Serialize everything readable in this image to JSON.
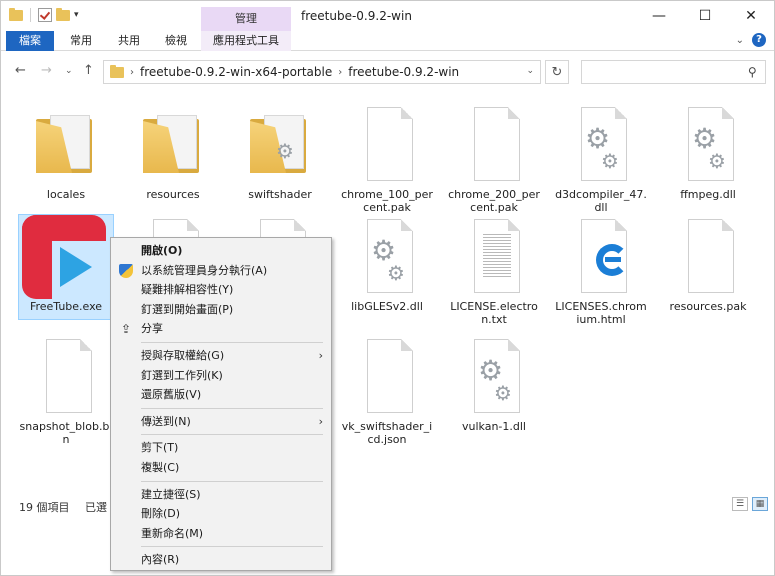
{
  "window": {
    "title": "freetube-0.9.2-win",
    "manage_tab": "管理"
  },
  "ribbon": {
    "tabs": [
      "檔案",
      "常用",
      "共用",
      "檢視",
      "應用程式工具"
    ]
  },
  "address": {
    "segments": [
      "freetube-0.9.2-win-x64-portable",
      "freetube-0.9.2-win"
    ],
    "search_placeholder": ""
  },
  "files": [
    {
      "name": "locales",
      "type": "folder"
    },
    {
      "name": "resources",
      "type": "folder"
    },
    {
      "name": "swiftshader",
      "type": "folder"
    },
    {
      "name": "chrome_100_percent.pak",
      "type": "blank"
    },
    {
      "name": "chrome_200_percent.pak",
      "type": "blank"
    },
    {
      "name": "d3dcompiler_47.dll",
      "type": "gear"
    },
    {
      "name": "ffmpeg.dll",
      "type": "gear"
    },
    {
      "name": "FreeTube.exe",
      "type": "app"
    },
    {
      "name": "libGLESv2.dll",
      "type": "gear"
    },
    {
      "name": "LICENSE.electron.txt",
      "type": "text"
    },
    {
      "name": "LICENSES.chromium.html",
      "type": "edge"
    },
    {
      "name": "resources.pak",
      "type": "blank"
    },
    {
      "name": "snapshot_blob.bin",
      "type": "blank"
    },
    {
      "name": "vk_swiftshader_icd.json",
      "type": "blank"
    },
    {
      "name": "vulkan-1.dll",
      "type": "gear"
    }
  ],
  "status": {
    "count": "19 個項目",
    "selected": "已選"
  },
  "context_menu": {
    "items": [
      {
        "label": "開啟(O)",
        "bold": true
      },
      {
        "label": "以系統管理員身分執行(A)",
        "icon": "shield-icon"
      },
      {
        "label": "疑難排解相容性(Y)"
      },
      {
        "label": "釘選到開始畫面(P)"
      },
      {
        "label": "分享",
        "icon": "share-icon"
      },
      {
        "sep": true
      },
      {
        "label": "授與存取權給(G)",
        "submenu": true
      },
      {
        "label": "釘選到工作列(K)"
      },
      {
        "label": "還原舊版(V)"
      },
      {
        "sep": true
      },
      {
        "label": "傳送到(N)",
        "submenu": true
      },
      {
        "sep": true
      },
      {
        "label": "剪下(T)"
      },
      {
        "label": "複製(C)"
      },
      {
        "sep": true
      },
      {
        "label": "建立捷徑(S)"
      },
      {
        "label": "刪除(D)"
      },
      {
        "label": "重新命名(M)"
      },
      {
        "sep": true
      },
      {
        "label": "內容(R)"
      }
    ]
  }
}
